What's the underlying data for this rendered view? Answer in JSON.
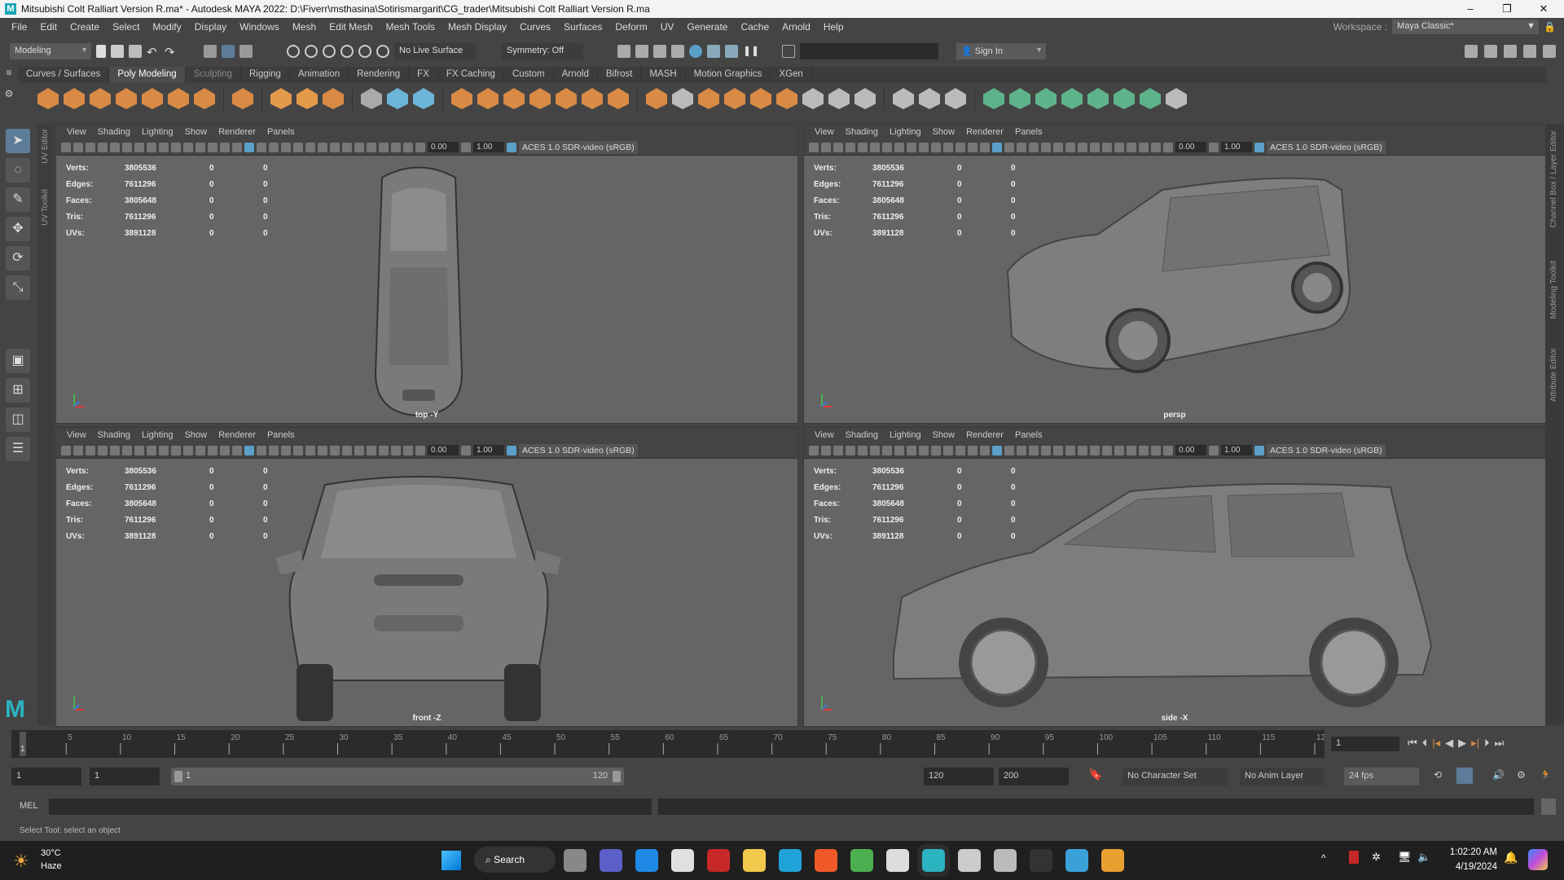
{
  "window": {
    "title": "Mitsubishi Colt Ralliart Version R.ma* - Autodesk MAYA 2022: D:\\Fiverr\\msthasina\\Sotirismargarit\\CG_trader\\Mitsubishi Colt Ralliart Version R.ma",
    "logo": "M",
    "minimize": "–",
    "maximize": "❐",
    "close": "✕"
  },
  "menu": [
    "File",
    "Edit",
    "Create",
    "Select",
    "Modify",
    "Display",
    "Windows",
    "Mesh",
    "Edit Mesh",
    "Mesh Tools",
    "Mesh Display",
    "Curves",
    "Surfaces",
    "Deform",
    "UV",
    "Generate",
    "Cache",
    "Arnold",
    "Help"
  ],
  "workspace": {
    "label": "Workspace :",
    "value": "Maya Classic*"
  },
  "statusline": {
    "mode": "Modeling",
    "live_surface": "No Live Surface",
    "symmetry": "Symmetry: Off",
    "sign_in": "Sign In"
  },
  "shelf_tabs": [
    "Curves / Surfaces",
    "Poly Modeling",
    "Sculpting",
    "Rigging",
    "Animation",
    "Rendering",
    "FX",
    "FX Caching",
    "Custom",
    "Arnold",
    "Bifrost",
    "MASH",
    "Motion Graphics",
    "XGen"
  ],
  "shelf_active": "Poly Modeling",
  "shelf_icons": [
    {
      "name": "poly-sphere-icon",
      "color": "#d98a45"
    },
    {
      "name": "poly-cube-icon",
      "color": "#d98a45"
    },
    {
      "name": "poly-cylinder-icon",
      "color": "#d98a45"
    },
    {
      "name": "poly-cone-icon",
      "color": "#d98a45"
    },
    {
      "name": "poly-torus-icon",
      "color": "#d98a45"
    },
    {
      "name": "poly-plane-icon",
      "color": "#d98a45"
    },
    {
      "name": "poly-disc-icon",
      "color": "#d98a45"
    },
    {
      "name": "sep"
    },
    {
      "name": "platonic-solid-icon",
      "color": "#d98a45"
    },
    {
      "name": "sep"
    },
    {
      "name": "super-shape-icon",
      "color": "#e39a4a"
    },
    {
      "name": "type-icon",
      "color": "#e39a4a"
    },
    {
      "name": "svg-icon",
      "color": "#d98a45"
    },
    {
      "name": "sep"
    },
    {
      "name": "measure-icon",
      "color": "#aaaaaa"
    },
    {
      "name": "transform-icon",
      "color": "#6cb4d8"
    },
    {
      "name": "freeze-icon",
      "color": "#6cb4d8"
    },
    {
      "name": "sep"
    },
    {
      "name": "combine-icon",
      "color": "#d98a45"
    },
    {
      "name": "separate-icon",
      "color": "#d98a45"
    },
    {
      "name": "mirror-icon",
      "color": "#d98a45"
    },
    {
      "name": "smooth-icon",
      "color": "#d98a45"
    },
    {
      "name": "reduce-icon",
      "color": "#d98a45"
    },
    {
      "name": "remesh-icon",
      "color": "#d98a45"
    },
    {
      "name": "retopo-icon",
      "color": "#d98a45"
    },
    {
      "name": "sep"
    },
    {
      "name": "extrude-icon",
      "color": "#d98a45"
    },
    {
      "name": "bridge-icon",
      "color": "#bbbbbb"
    },
    {
      "name": "bevel-icon",
      "color": "#d98a45"
    },
    {
      "name": "fill-hole-icon",
      "color": "#d98a45"
    },
    {
      "name": "append-icon",
      "color": "#d98a45"
    },
    {
      "name": "wedge-icon",
      "color": "#d98a45"
    },
    {
      "name": "poke-icon",
      "color": "#bbbbbb"
    },
    {
      "name": "boolean-icon",
      "color": "#bbbbbb"
    },
    {
      "name": "bounding-box-icon",
      "color": "#bbbbbb"
    },
    {
      "name": "sep"
    },
    {
      "name": "multicut-icon",
      "color": "#bbbbbb"
    },
    {
      "name": "edge-loop-icon",
      "color": "#bbbbbb"
    },
    {
      "name": "knife-icon",
      "color": "#bbbbbb"
    },
    {
      "name": "sep"
    },
    {
      "name": "uv-planar-icon",
      "color": "#5fb38a"
    },
    {
      "name": "uv-cylindrical-icon",
      "color": "#5fb38a"
    },
    {
      "name": "uv-spherical-icon",
      "color": "#5fb38a"
    },
    {
      "name": "uv-auto-icon",
      "color": "#5fb38a"
    },
    {
      "name": "uv-contour-icon",
      "color": "#5fb38a"
    },
    {
      "name": "uv-layout-icon",
      "color": "#5fb38a"
    },
    {
      "name": "uv-unfold-icon",
      "color": "#5fb38a"
    },
    {
      "name": "uv-cut-icon",
      "color": "#bbbbbb"
    }
  ],
  "tools": [
    "select-tool-icon",
    "lasso-tool-icon",
    "paint-select-icon",
    "move-tool-icon",
    "rotate-tool-icon",
    "scale-tool-icon"
  ],
  "left_tabs": [
    "UV Editor",
    "UV Toolkit"
  ],
  "right_tabs": [
    "Channel Box / Layer Editor",
    "Modeling Toolkit",
    "Attribute Editor"
  ],
  "viewport_menu": [
    "View",
    "Shading",
    "Lighting",
    "Show",
    "Renderer",
    "Panels"
  ],
  "viewport_fields": {
    "exposure": "0.00",
    "gamma": "1.00",
    "color_space": "ACES 1.0 SDR-video (sRGB)"
  },
  "hud": [
    [
      "Verts:",
      "3805536",
      "0",
      "0"
    ],
    [
      "Edges:",
      "7611296",
      "0",
      "0"
    ],
    [
      "Faces:",
      "3805648",
      "0",
      "0"
    ],
    [
      "Tris:",
      "7611296",
      "0",
      "0"
    ],
    [
      "UVs:",
      "3891128",
      "0",
      "0"
    ]
  ],
  "viewports": [
    {
      "label": "top -Y",
      "view": "top"
    },
    {
      "label": "persp",
      "view": "persp"
    },
    {
      "label": "front -Z",
      "view": "front"
    },
    {
      "label": "side -X",
      "view": "side"
    }
  ],
  "timeline": {
    "start": 1,
    "end": 120,
    "current": 1,
    "current_field": "1"
  },
  "range": {
    "anim_start": "1",
    "play_start": "1",
    "slider_start": "1",
    "slider_end": "120",
    "play_end": "120",
    "anim_end": "200",
    "character_set": "No Character Set",
    "anim_layer": "No Anim Layer",
    "fps": "24 fps"
  },
  "mel": {
    "label": "MEL"
  },
  "helpline": "Select Tool: select an object",
  "taskbar": {
    "temp": "30°C",
    "weather": "Haze",
    "search": "Search",
    "time": "1:02:20 AM",
    "date": "4/19/2024",
    "apps": [
      {
        "name": "task-view-icon",
        "color": "#888888"
      },
      {
        "name": "teams-icon",
        "color": "#5b5fc7"
      },
      {
        "name": "mail-icon",
        "color": "#1e88e5"
      },
      {
        "name": "store-icon",
        "color": "#e0e0e0"
      },
      {
        "name": "wps-icon",
        "color": "#c62828"
      },
      {
        "name": "file-explorer-icon",
        "color": "#f2c94c"
      },
      {
        "name": "edge-icon",
        "color": "#1fa3d8"
      },
      {
        "name": "brave-icon",
        "color": "#f05a28"
      },
      {
        "name": "chrome-icon",
        "color": "#4caf50"
      },
      {
        "name": "zbrush-icon",
        "color": "#dddddd"
      },
      {
        "name": "maya-icon",
        "color": "#2bb3c0"
      },
      {
        "name": "rhino-icon",
        "color": "#cccccc"
      },
      {
        "name": "unity-icon",
        "color": "#bbbbbb"
      },
      {
        "name": "epic-games-icon",
        "color": "#333333"
      },
      {
        "name": "maya-lt-icon",
        "color": "#3aa0d8"
      },
      {
        "name": "chrome-canary-icon",
        "color": "#e8a030"
      }
    ]
  }
}
